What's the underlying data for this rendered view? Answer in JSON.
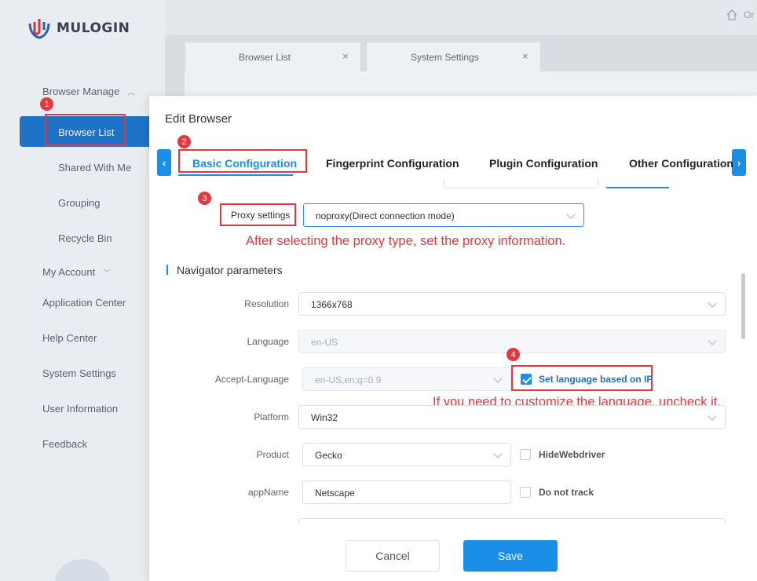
{
  "logo": {
    "name": "MULOGIN"
  },
  "sidebar": {
    "browser_manage": "Browser Manage",
    "browser_list": "Browser List",
    "shared_with_me": "Shared With Me",
    "grouping": "Grouping",
    "recycle_bin": "Recycle Bin",
    "my_account": "My Account",
    "application_center": "Application Center",
    "help_center": "Help Center",
    "system_settings": "System Settings",
    "user_information": "User Information",
    "feedback": "Feedback"
  },
  "topbar": {
    "truncated_text": "Or"
  },
  "app_tabs": [
    {
      "label": "Browser List",
      "close": "×"
    },
    {
      "label": "System Settings",
      "close": "×"
    }
  ],
  "modal": {
    "title": "Edit Browser",
    "config_tabs": [
      "Basic Configuration",
      "Fingerprint Configuration",
      "Plugin Configuration",
      "Other Configuration"
    ],
    "scroll_left": "‹",
    "scroll_right": "›",
    "proxy": {
      "label": "Proxy settings",
      "value": "noproxy(Direct connection mode)"
    },
    "section_title": "Navigator parameters",
    "fields": {
      "resolution": {
        "label": "Resolution",
        "value": "1366x768"
      },
      "language": {
        "label": "Language",
        "value": "en-US"
      },
      "accept_language": {
        "label": "Accept-Language",
        "value": "en-US,en;q=0.9"
      },
      "platform": {
        "label": "Platform",
        "value": "Win32"
      },
      "product": {
        "label": "Product",
        "value": "Gecko"
      },
      "appname": {
        "label": "appName",
        "value": "Netscape"
      }
    },
    "checkboxes": {
      "set_language_ip": {
        "label": "Set language based on IP",
        "checked": true
      },
      "hide_webdriver": {
        "label": "HideWebdriver",
        "checked": false
      },
      "do_not_track": {
        "label": "Do not track",
        "checked": false
      }
    },
    "buttons": {
      "cancel": "Cancel",
      "save": "Save"
    }
  },
  "annotations": {
    "markers": [
      "1",
      "2",
      "3",
      "4"
    ],
    "note_proxy": "After selecting the proxy type, set the proxy information.",
    "note_language": "If you need to customize the language, uncheck it."
  },
  "colors": {
    "accent": "#1b8fe8",
    "annotation": "#e3383f",
    "active_nav": "#1f73c6"
  }
}
